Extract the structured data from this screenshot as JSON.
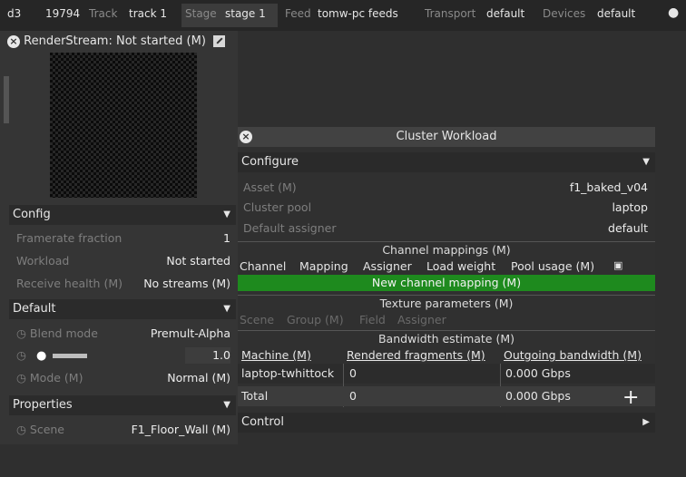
{
  "topbar": {
    "app": "d3",
    "project_num": "19794",
    "track_label": "Track",
    "track_value": "track 1",
    "stage_label": "Stage",
    "stage_value": "stage 1",
    "feed_label": "Feed",
    "feed_value": "tomw-pc feeds",
    "transport_label": "Transport",
    "transport_value": "default",
    "devices_label": "Devices",
    "devices_value": "default"
  },
  "renderstream": {
    "title": "RenderStream: Not started (M)"
  },
  "config": {
    "title": "Config",
    "rows": [
      {
        "label": "Framerate fraction",
        "value": "1"
      },
      {
        "label": "Workload",
        "value": "Not started"
      },
      {
        "label": "Receive health (M)",
        "value": "No streams (M)"
      }
    ]
  },
  "default_section": {
    "title": "Default",
    "blend_label": "Blend mode",
    "blend_value": "Premult-Alpha",
    "brightness_value": "1.0",
    "mode_label": "Mode (M)",
    "mode_value": "Normal (M)"
  },
  "properties": {
    "title": "Properties",
    "scene_label": "Scene",
    "scene_value": "F1_Floor_Wall (M)"
  },
  "cluster": {
    "title": "Cluster Workload",
    "configure_title": "Configure",
    "asset_label": "Asset (M)",
    "asset_value": "f1_baked_v04",
    "pool_label": "Cluster pool",
    "pool_value": "laptop",
    "assigner_label": "Default assigner",
    "assigner_value": "default",
    "channel_mappings_title": "Channel mappings (M)",
    "channel_cols": [
      "Channel",
      "Mapping",
      "Assigner",
      "Load weight",
      "Pool usage (M)"
    ],
    "new_mapping_label": "New channel mapping (M)",
    "texture_title": "Texture parameters (M)",
    "texture_cols": [
      "Scene",
      "Group (M)",
      "Field",
      "Assigner"
    ],
    "bandwidth_title": "Bandwidth estimate (M)",
    "bw_cols": [
      "Machine (M)",
      "Rendered fragments (M)",
      "Outgoing bandwidth (M)"
    ],
    "bw_rows": [
      {
        "machine": "laptop-twhittock",
        "fragments": "0",
        "bandwidth": "0.000 Gbps"
      },
      {
        "machine": "Total",
        "fragments": "0",
        "bandwidth": "0.000 Gbps"
      }
    ],
    "control_title": "Control"
  },
  "colors": {
    "accent_green": "#1e8a1e",
    "panel": "#353535",
    "header": "#2b2b2b"
  }
}
